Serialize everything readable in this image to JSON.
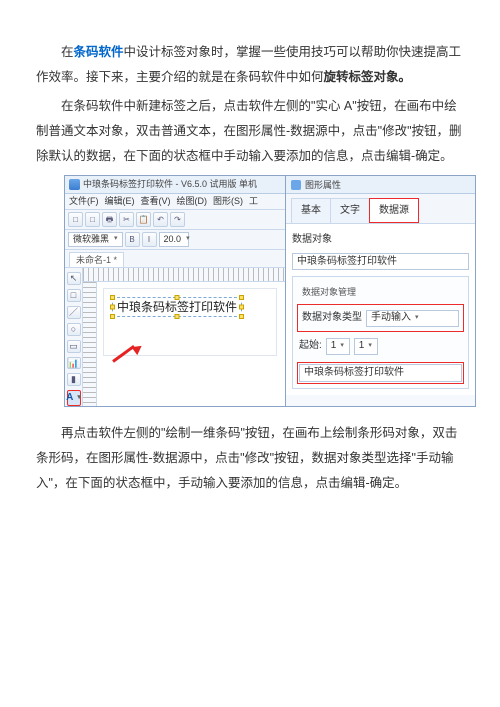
{
  "paragraphs": {
    "p1_before_link": "在",
    "p1_link": "条码软件",
    "p1_after_link": "中设计标签对象时，掌握一些使用技巧可以帮助你快速提高工作效率。接下来，主要介绍的就是在条码软件中如何",
    "p1_bold": "旋转标签对象。",
    "p2": "在条码软件中新建标签之后，点击软件左侧的\"实心 A\"按钮，在画布中绘制普通文本对象，双击普通文本，在图形属性-数据源中，点击\"修改\"按钮，删除默认的数据，在下面的状态框中手动输入要添加的信息，点击编辑-确定。",
    "p3": "再点击软件左侧的\"绘制一维条码\"按钮，在画布上绘制条形码对象，双击条形码，在图形属性-数据源中，点击\"修改\"按钮，数据对象类型选择\"手动输入\"，在下面的状态框中，手动输入要添加的信息，点击编辑-确定。"
  },
  "app": {
    "title": "中琅条码标签打印软件 - V6.5.0 试用版 单机",
    "menu": [
      "文件(F)",
      "编辑(E)",
      "查看(V)",
      "绘图(D)",
      "图形(S)",
      "工"
    ],
    "toolbar_icons": [
      "□",
      "□",
      "🖶",
      "✂",
      "📋",
      "↶",
      "↷"
    ],
    "font_name": "微软雅黑",
    "font_size": "20.0",
    "file_tab": "未命名-1 *",
    "side_tools": [
      "↖",
      "□",
      "／",
      "○",
      "▭",
      "📊",
      "▮",
      "A"
    ],
    "text_object": "中琅条码标签打印软件"
  },
  "props": {
    "title": "图形属性",
    "tabs": [
      "基本",
      "文字",
      "数据源"
    ],
    "obj_label": "数据对象",
    "obj_value": "中琅条码标签打印软件",
    "sub_title": "数据对象管理",
    "type_label": "数据对象类型",
    "type_value": "手动输入",
    "start_label": "起始:",
    "start_value": "1",
    "input_value": "中琅条码标签打印软件"
  }
}
